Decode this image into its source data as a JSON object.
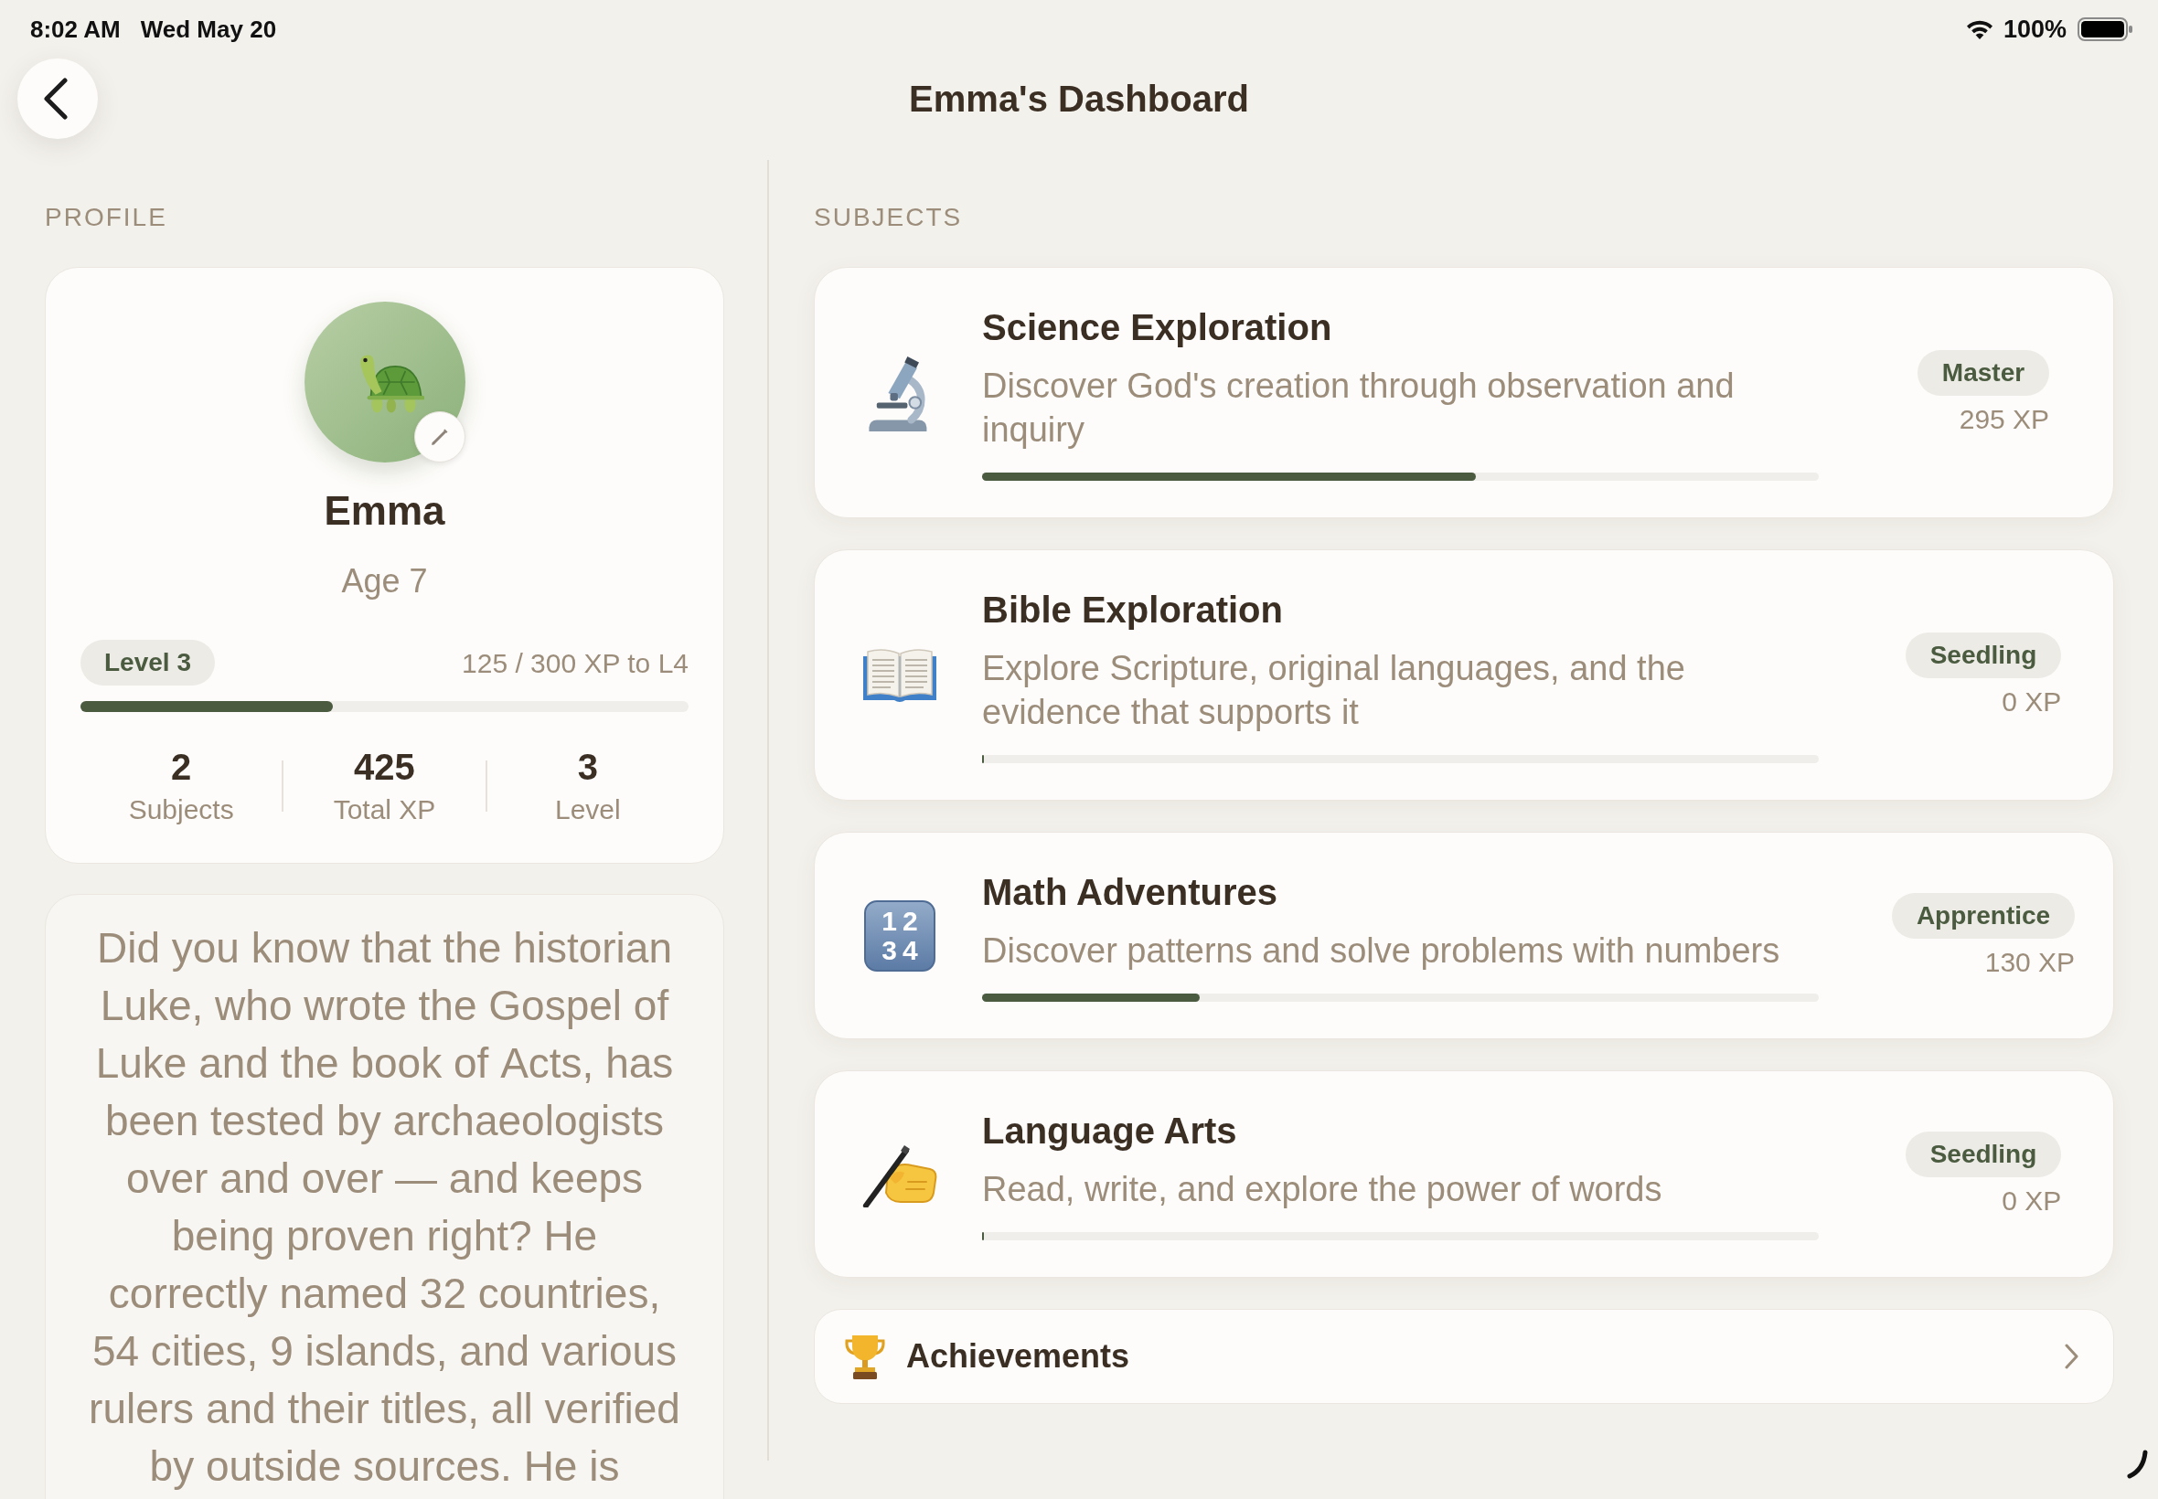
{
  "status_bar": {
    "time": "8:02 AM",
    "date": "Wed May 20",
    "battery": "100%"
  },
  "header": {
    "title": "Emma's Dashboard"
  },
  "profile": {
    "section_label": "PROFILE",
    "name": "Emma",
    "age": "Age 7",
    "level_badge": "Level 3",
    "xp_progress": "125 / 300 XP to L4",
    "level": 0.415,
    "stats": [
      {
        "value": "2",
        "label": "Subjects"
      },
      {
        "value": "425",
        "label": "Total XP"
      },
      {
        "value": "3",
        "label": "Level"
      }
    ]
  },
  "fact": {
    "text": "Did you know that the historian Luke, who wrote the Gospel of Luke and the book of Acts, has been tested by archaeologists over and over — and keeps being proven right? He correctly named 32 countries, 54 cities, 9 islands, and various rulers and their titles, all verified by outside sources. He is"
  },
  "subjects": {
    "section_label": "SUBJECTS",
    "items": [
      {
        "title": "Science Exploration",
        "description": "Discover God's creation through observation and inquiry",
        "badge": "Master",
        "xp": "295 XP",
        "level": 0.59
      },
      {
        "title": "Bible Exploration",
        "description": "Explore Scripture, original languages, and the evidence that supports it",
        "badge": "Seedling",
        "xp": "0 XP",
        "level": 0
      },
      {
        "title": "Math Adventures",
        "description": "Discover patterns and solve problems with numbers",
        "badge": "Apprentice",
        "xp": "130 XP",
        "level": 0.26,
        "icon_lines": [
          "12",
          "34"
        ]
      },
      {
        "title": "Language Arts",
        "description": "Read, write, and explore the power of words",
        "badge": "Seedling",
        "xp": "0 XP",
        "level": 0
      }
    ]
  },
  "achievements": {
    "label": "Achievements"
  }
}
